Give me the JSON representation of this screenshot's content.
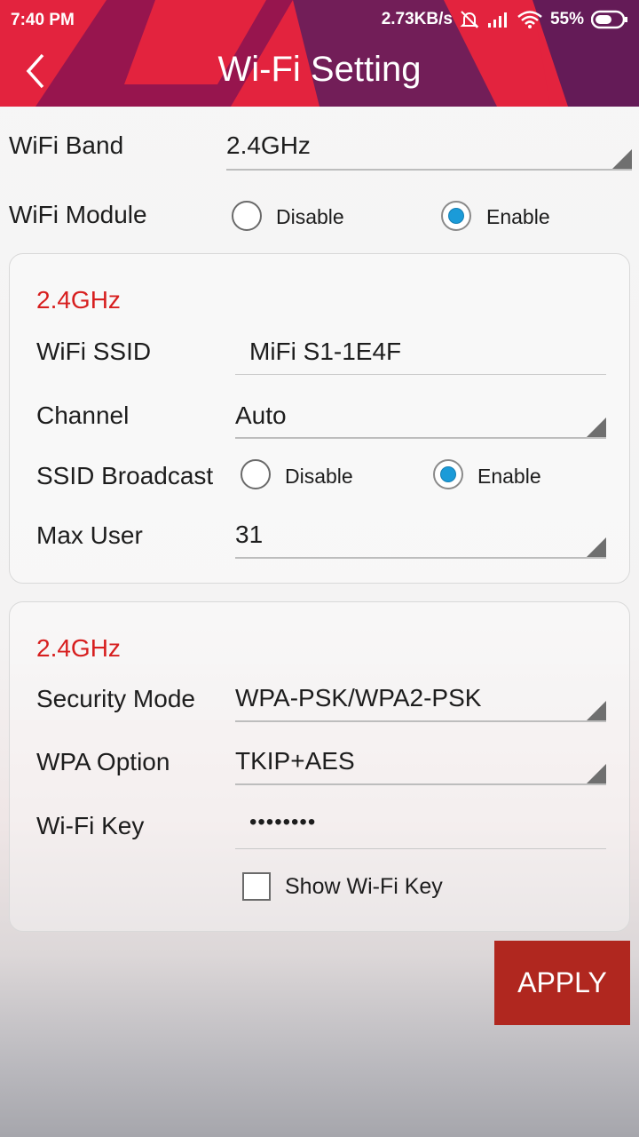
{
  "status_bar": {
    "time": "7:40 PM",
    "net_speed": "2.73KB/s",
    "battery": "55%",
    "icons": [
      "mute-bell-icon",
      "signal-icon",
      "wifi-icon",
      "battery-icon"
    ]
  },
  "header": {
    "title": "Wi-Fi Setting",
    "back_icon": "chevron-left-icon",
    "accent": "#e3233e"
  },
  "wifi_band": {
    "label": "WiFi Band",
    "value": "2.4GHz"
  },
  "wifi_module": {
    "label": "WiFi Module",
    "options": [
      {
        "label": "Disable",
        "selected": false
      },
      {
        "label": "Enable",
        "selected": true
      }
    ]
  },
  "basic_section": {
    "title": "2.4GHz",
    "ssid": {
      "label": "WiFi SSID",
      "value": "MiFi S1-1E4F"
    },
    "channel": {
      "label": "Channel",
      "value": "Auto"
    },
    "ssid_broadcast": {
      "label": "SSID Broadcast",
      "options": [
        {
          "label": "Disable",
          "selected": false
        },
        {
          "label": "Enable",
          "selected": true
        }
      ]
    },
    "max_user": {
      "label": "Max User",
      "value": "31"
    }
  },
  "security_section": {
    "title": "2.4GHz",
    "security_mode": {
      "label": "Security Mode",
      "value": "WPA-PSK/WPA2-PSK"
    },
    "wpa_option": {
      "label": "WPA Option",
      "value": "TKIP+AES"
    },
    "wifi_key": {
      "label": "Wi-Fi Key",
      "value": "••••••••"
    },
    "show_key": {
      "label": "Show Wi-Fi Key",
      "checked": false
    }
  },
  "apply_label": "APPLY",
  "colors": {
    "section_title": "#d71f1f",
    "radio_selected": "#1b9bd8",
    "apply_bg": "#b0271f"
  }
}
